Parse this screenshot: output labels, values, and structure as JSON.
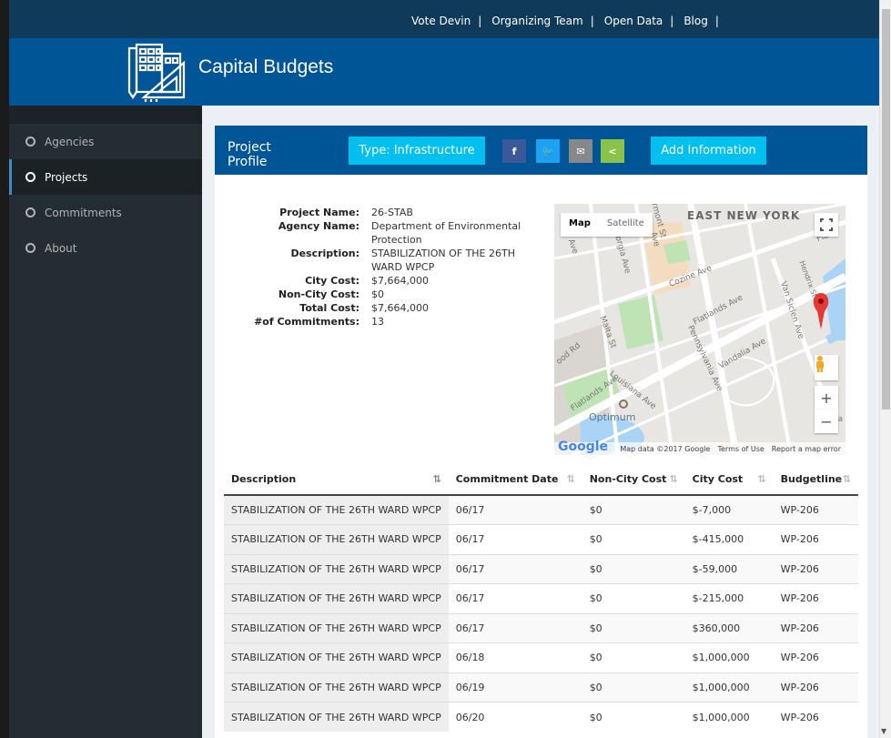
{
  "topnav": {
    "items": [
      "Vote Devin",
      "Organizing Team",
      "Open Data",
      "Blog"
    ],
    "separator": "|"
  },
  "header": {
    "title": "Capital Budgets",
    "logo_icon": "building-plan-logo"
  },
  "sidebar": {
    "items": [
      {
        "label": "Agencies",
        "active": false
      },
      {
        "label": "Projects",
        "active": true
      },
      {
        "label": "Commitments",
        "active": false
      },
      {
        "label": "About",
        "active": false
      }
    ]
  },
  "profile_box": {
    "title": "Project Profile",
    "type_button": "Type: Infrastructure",
    "add_button": "Add Information",
    "share_icons": [
      "facebook-icon",
      "twitter-icon",
      "email-icon",
      "share-icon"
    ],
    "social_glyphs": {
      "facebook": "f",
      "twitter": "🐦",
      "email": "✉",
      "share": "<"
    }
  },
  "profile": [
    {
      "label": "Project Name:",
      "value": "26-STAB"
    },
    {
      "label": "Agency Name:",
      "value": "Department of Environmental Protection"
    },
    {
      "label": "Description:",
      "value": "STABILIZATION OF THE 26TH WARD WPCP"
    },
    {
      "label": "City Cost:",
      "value": "$7,664,000"
    },
    {
      "label": "Non-City Cost:",
      "value": "$0"
    },
    {
      "label": "Total Cost:",
      "value": "$7,664,000"
    },
    {
      "label": "#of Commitments:",
      "value": "13"
    }
  ],
  "map": {
    "toggle_map": "Map",
    "toggle_satellite": "Satellite",
    "area_label": "EAST NEW YORK",
    "place_label": "Optimum",
    "streets": [
      "Vermont St",
      "Georgia Ave",
      "Cozine Ave",
      "Flatlands Ave",
      "Van Siclen Ave",
      "Malta St",
      "Pennsylvania Ave",
      "Vandalia Ave",
      "Louisiana Ave",
      "Hendrix St",
      "Flatlands Ave",
      "Flatla",
      "Ave",
      "Ave",
      "Ave",
      "Va",
      "ood Rd"
    ],
    "zoom_in": "+",
    "zoom_out": "−",
    "brand": "Google",
    "footer": [
      "Map data ©2017 Google",
      "Terms of Use",
      "Report a map error"
    ]
  },
  "table": {
    "columns": [
      "Description",
      "Commitment Date",
      "Non-City Cost",
      "City Cost",
      "Budgetline"
    ],
    "sort_glyph": "⇅",
    "rows": [
      [
        "STABILIZATION OF THE 26TH WARD WPCP",
        "06/17",
        "$0",
        "$-7,000",
        "WP-206"
      ],
      [
        "STABILIZATION OF THE 26TH WARD WPCP",
        "06/17",
        "$0",
        "$-415,000",
        "WP-206"
      ],
      [
        "STABILIZATION OF THE 26TH WARD WPCP",
        "06/17",
        "$0",
        "$-59,000",
        "WP-206"
      ],
      [
        "STABILIZATION OF THE 26TH WARD WPCP",
        "06/17",
        "$0",
        "$-215,000",
        "WP-206"
      ],
      [
        "STABILIZATION OF THE 26TH WARD WPCP",
        "06/17",
        "$0",
        "$360,000",
        "WP-206"
      ],
      [
        "STABILIZATION OF THE 26TH WARD WPCP",
        "06/18",
        "$0",
        "$1,000,000",
        "WP-206"
      ],
      [
        "STABILIZATION OF THE 26TH WARD WPCP",
        "06/19",
        "$0",
        "$1,000,000",
        "WP-206"
      ],
      [
        "STABILIZATION OF THE 26TH WARD WPCP",
        "06/20",
        "$0",
        "$1,000,000",
        "WP-206"
      ]
    ]
  },
  "colors": {
    "nav_dark": "#0f3a5a",
    "brand_blue": "#005596",
    "button_cyan": "#00c0ef",
    "sidebar": "#232d33"
  }
}
